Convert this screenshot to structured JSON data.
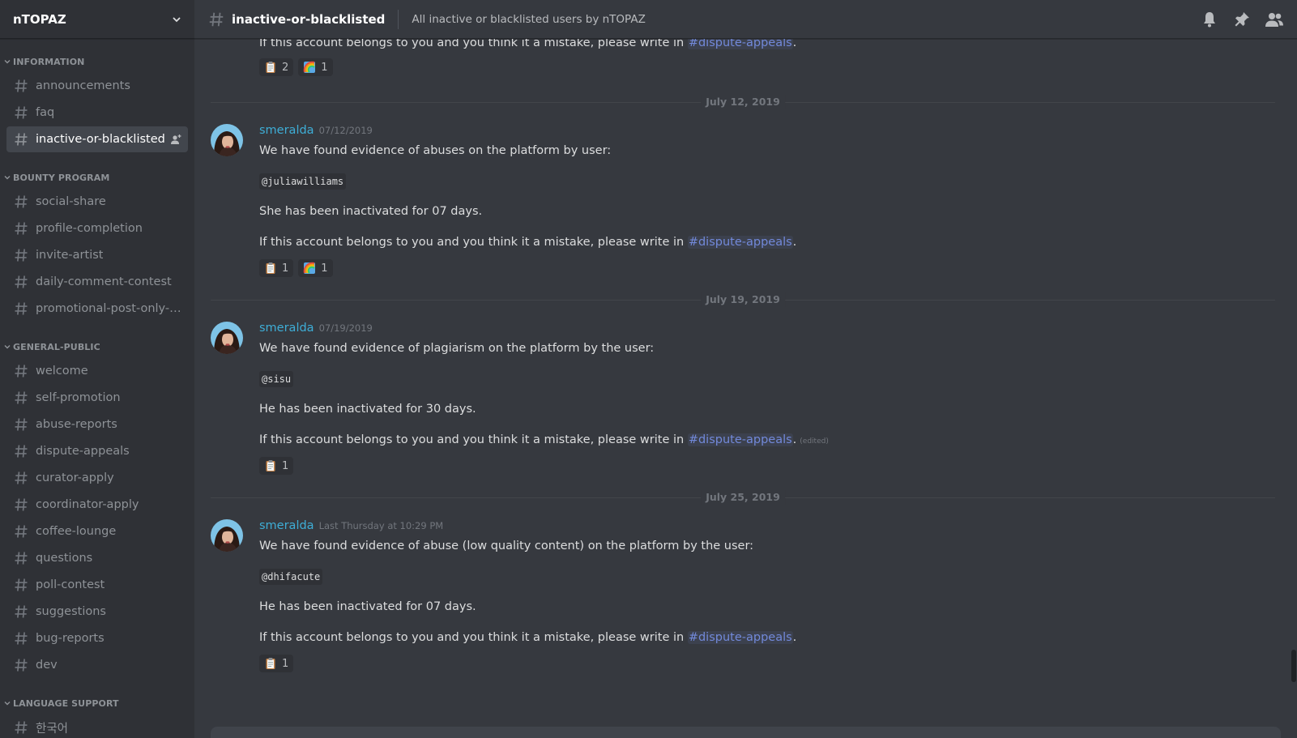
{
  "server": {
    "name": "nTOPAZ"
  },
  "sidebar": {
    "categories": [
      {
        "label": "INFORMATION",
        "channels": [
          "announcements",
          "faq",
          "inactive-or-blacklisted"
        ]
      },
      {
        "label": "BOUNTY PROGRAM",
        "channels": [
          "social-share",
          "profile-completion",
          "invite-artist",
          "daily-comment-contest",
          "promotional-post-only-f..."
        ]
      },
      {
        "label": "GENERAL-PUBLIC",
        "channels": [
          "welcome",
          "self-promotion",
          "abuse-reports",
          "dispute-appeals",
          "curator-apply",
          "coordinator-apply",
          "coffee-lounge",
          "questions",
          "poll-contest",
          "suggestions",
          "bug-reports",
          "dev"
        ]
      },
      {
        "label": "LANGUAGE SUPPORT",
        "channels": [
          "한국어"
        ]
      }
    ],
    "active_channel": "inactive-or-blacklisted"
  },
  "header": {
    "channel": "inactive-or-blacklisted",
    "topic": "All inactive or blacklisted users by nTOPAZ",
    "icons": [
      "bell-icon",
      "pin-icon",
      "members-icon"
    ]
  },
  "partial_message": {
    "text_before": "If this account belongs to you and you think it a mistake, please write in ",
    "mention": "#dispute-appeals",
    "text_after": ".",
    "reactions": [
      {
        "emoji": "clipboard-icon",
        "count": "2"
      },
      {
        "emoji": "rainbow-icon",
        "count": "1"
      }
    ]
  },
  "messages": [
    {
      "date_divider": "July 12, 2019",
      "author": "smeralda",
      "timestamp": "07/12/2019",
      "intro": "We have found evidence of abuses on the platform by user:",
      "handle": "@juliawilliams",
      "duration": "She has been inactivated for 07 days.",
      "appeal_before": "If this account belongs to you and you think it a mistake, please write in ",
      "mention": "#dispute-appeals",
      "appeal_after": ".",
      "edited": "",
      "reactions": [
        {
          "emoji": "clipboard-icon",
          "count": "1"
        },
        {
          "emoji": "rainbow-icon",
          "count": "1"
        }
      ]
    },
    {
      "date_divider": "July 19, 2019",
      "author": "smeralda",
      "timestamp": "07/19/2019",
      "intro": "We have found evidence of plagiarism on the platform by the user:",
      "handle": "@sisu",
      "duration": "He has been inactivated for 30 days.",
      "appeal_before": "If this account belongs to you and you think it a mistake, please write in ",
      "mention": "#dispute-appeals",
      "appeal_after": ".",
      "edited": "(edited)",
      "reactions": [
        {
          "emoji": "clipboard-icon",
          "count": "1"
        }
      ]
    },
    {
      "date_divider": "July 25, 2019",
      "author": "smeralda",
      "timestamp": "Last Thursday at 10:29 PM",
      "intro": "We have found evidence of abuse (low quality content) on the platform by the user:",
      "handle": "@dhifacute",
      "duration": "He has been inactivated for 07 days.",
      "appeal_before": "If this account belongs to you and you think it a mistake, please write in ",
      "mention": "#dispute-appeals",
      "appeal_after": ".",
      "edited": "",
      "reactions": [
        {
          "emoji": "clipboard-icon",
          "count": "1"
        }
      ]
    }
  ],
  "colors": {
    "background": "#36393f",
    "sidebar": "#2f3136",
    "accent": "#7289da",
    "username": "#3eaed7"
  }
}
